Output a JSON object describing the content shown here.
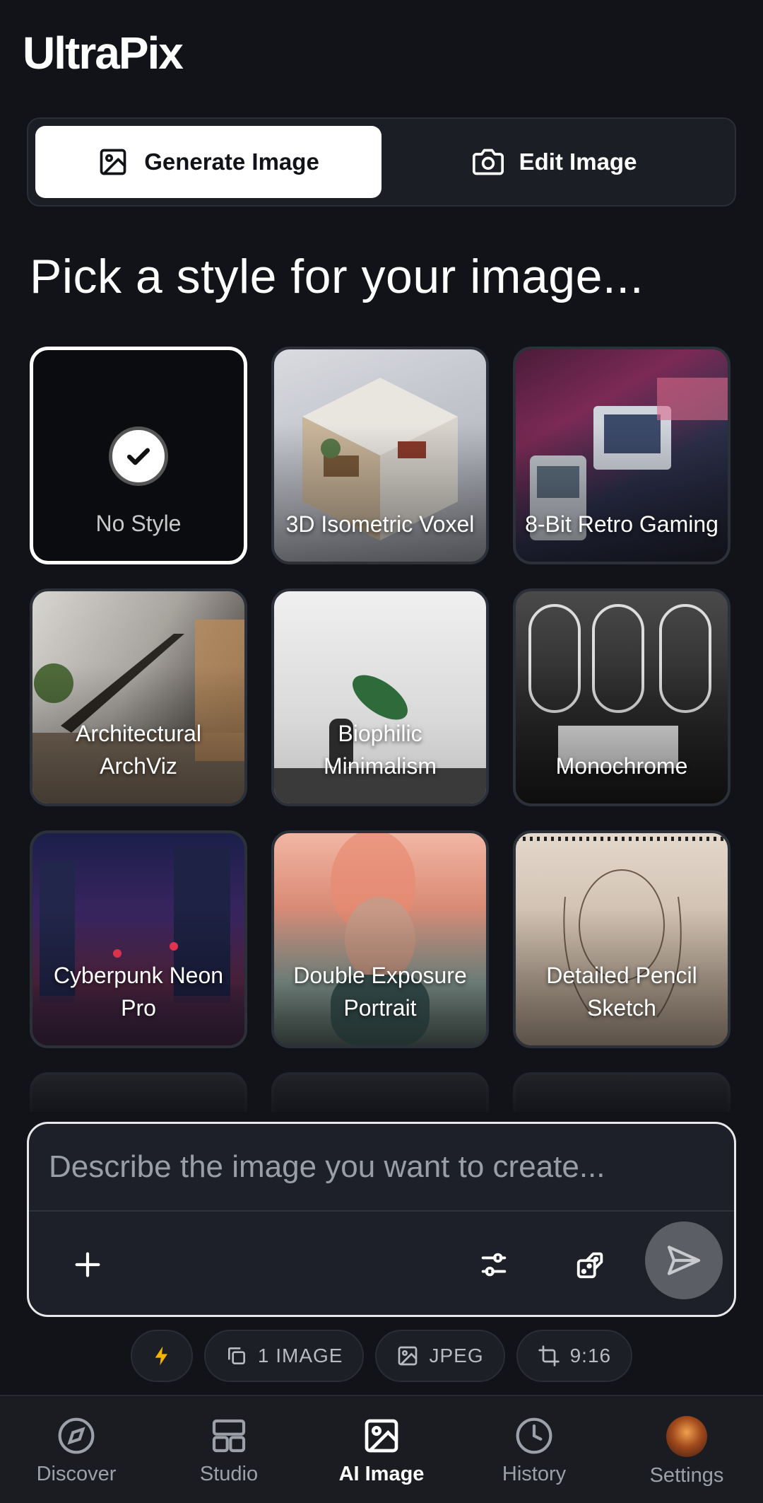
{
  "app": {
    "title": "UltraPix"
  },
  "mode_switch": {
    "generate_label": "Generate Image",
    "edit_label": "Edit Image",
    "active": "Generate Image"
  },
  "heading": "Pick a style for your image...",
  "styles": [
    {
      "label": "No Style",
      "selected": true
    },
    {
      "label": "3D Isometric Voxel",
      "selected": false
    },
    {
      "label": "8-Bit Retro Gaming",
      "selected": false
    },
    {
      "label": "Architectural ArchViz",
      "selected": false
    },
    {
      "label": "Biophilic Minimalism",
      "selected": false
    },
    {
      "label": "Monochrome",
      "selected": false
    },
    {
      "label": "Cyberpunk Neon Pro",
      "selected": false
    },
    {
      "label": "Double Exposure Portrait",
      "selected": false
    },
    {
      "label": "Detailed Pencil Sketch",
      "selected": false
    }
  ],
  "composer": {
    "placeholder": "Describe the image you want to create...",
    "value": ""
  },
  "chips": {
    "count": "1 IMAGE",
    "format": "JPEG",
    "ratio": "9:16"
  },
  "tabs": [
    {
      "label": "Discover",
      "icon": "compass-icon"
    },
    {
      "label": "Studio",
      "icon": "grid-icon"
    },
    {
      "label": "AI Image",
      "icon": "image-icon",
      "active": true
    },
    {
      "label": "History",
      "icon": "clock-icon"
    },
    {
      "label": "Settings",
      "icon": "avatar"
    }
  ],
  "colors": {
    "background": "#111318",
    "accent": "#ffffff",
    "send_button": "#5b5e64"
  }
}
